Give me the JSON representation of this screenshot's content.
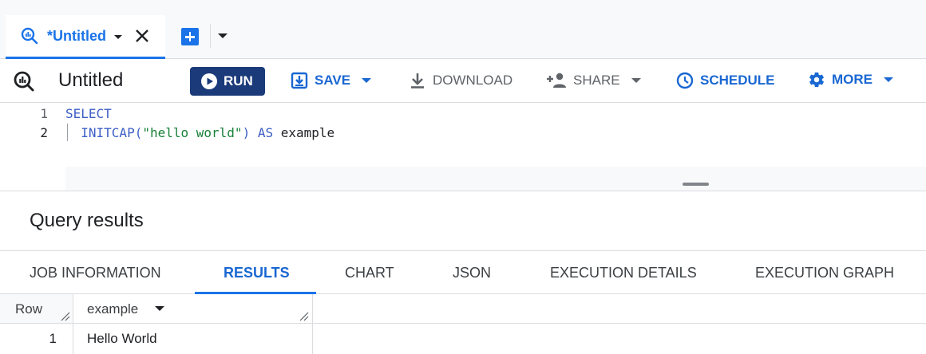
{
  "tab": {
    "label": "*Untitled"
  },
  "toolbar": {
    "title": "Untitled",
    "run": "RUN",
    "save": "SAVE",
    "download": "DOWNLOAD",
    "share": "SHARE",
    "schedule": "SCHEDULE",
    "more": "MORE"
  },
  "editor": {
    "lines": [
      {
        "num": "1",
        "tokens": [
          {
            "t": "SELECT",
            "c": "kw"
          }
        ]
      },
      {
        "num": "2",
        "tokens": [
          {
            "t": "  INITCAP(",
            "c": "kw"
          },
          {
            "t": "\"hello world\"",
            "c": "str"
          },
          {
            "t": ") ",
            "c": "kw"
          },
          {
            "t": "AS",
            "c": "kw"
          },
          {
            "t": " example",
            "c": "plain"
          }
        ]
      }
    ]
  },
  "results": {
    "title": "Query results",
    "tabs": [
      "JOB INFORMATION",
      "RESULTS",
      "CHART",
      "JSON",
      "EXECUTION DETAILS",
      "EXECUTION GRAPH"
    ],
    "active_tab": "RESULTS",
    "columns": [
      "Row",
      "example"
    ],
    "rows": [
      {
        "row": "1",
        "example": "Hello World"
      }
    ]
  },
  "colors": {
    "accent": "#1a73e8",
    "run_button": "#1b3a7a",
    "keyword": "#3c5fc4",
    "string": "#188038"
  },
  "icons": [
    "query-icon",
    "close-icon",
    "add-tab-icon",
    "play-icon",
    "save-icon",
    "download-icon",
    "share-icon",
    "schedule-icon",
    "gear-icon"
  ]
}
